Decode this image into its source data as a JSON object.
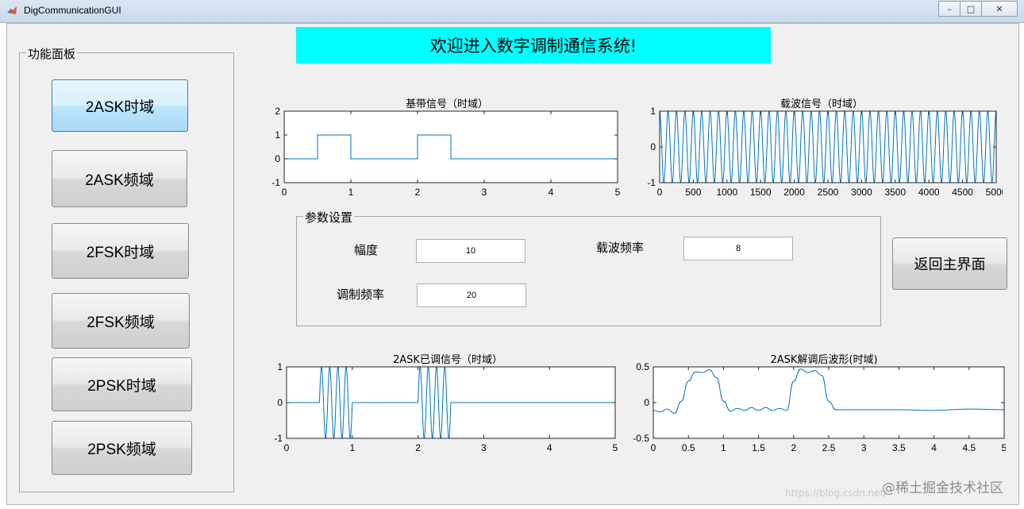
{
  "window": {
    "title": "DigCommunicationGUI"
  },
  "banner": {
    "text": "欢迎进入数字调制通信系统!"
  },
  "function_panel": {
    "title": "功能面板",
    "buttons": [
      "2ASK时域",
      "2ASK频域",
      "2FSK时域",
      "2FSK频域",
      "2PSK时域",
      "2PSK频域"
    ]
  },
  "parameters": {
    "title": "参数设置",
    "amplitude_label": "幅度",
    "amplitude_value": "10",
    "carrier_freq_label": "载波频率",
    "carrier_freq_value": "8",
    "mod_freq_label": "调制频率",
    "mod_freq_value": "20"
  },
  "return_button": "返回主界面",
  "watermark": "https://blog.csdn.net/",
  "watermark2": "@稀土掘金技术社区",
  "line_color": "#0072bd",
  "chart_data": [
    {
      "type": "line",
      "title": "基带信号（时域）",
      "xlim": [
        0,
        5
      ],
      "ylim": [
        -1,
        2
      ],
      "xticks": [
        "0",
        "1",
        "2",
        "3",
        "4",
        "5"
      ],
      "yticks": [
        "-1",
        "0",
        "1",
        "2"
      ],
      "series": [
        {
          "x": [
            0,
            0.5,
            0.5,
            1,
            1,
            2,
            2,
            2.5,
            2.5,
            5
          ],
          "y": [
            0,
            0,
            1,
            1,
            0,
            0,
            1,
            1,
            0,
            0
          ]
        }
      ]
    },
    {
      "type": "line",
      "title": "载波信号（时域）",
      "xlim": [
        0,
        5000
      ],
      "ylim": [
        -1,
        1
      ],
      "xticks": [
        "0",
        "500",
        "1000",
        "1500",
        "2000",
        "2500",
        "3000",
        "3500",
        "4000",
        "4500",
        "5000"
      ],
      "yticks": [
        "-1",
        "0",
        "1"
      ],
      "carrier_cycles": 40
    },
    {
      "type": "line",
      "title": "2ASK已调信号（时域）",
      "xlim": [
        0,
        5
      ],
      "ylim": [
        -1,
        1
      ],
      "xticks": [
        "0",
        "1",
        "2",
        "3",
        "4",
        "5"
      ],
      "yticks": [
        "-1",
        "0",
        "1"
      ],
      "carrier_freq": 8,
      "on_intervals": [
        [
          0.5,
          1
        ],
        [
          2,
          2.5
        ]
      ]
    },
    {
      "type": "line",
      "title": "2ASK解调后波形(时域)",
      "xlim": [
        0,
        5
      ],
      "ylim": [
        -0.5,
        0.5
      ],
      "xticks": [
        "0",
        "0.5",
        "1",
        "1.5",
        "2",
        "2.5",
        "3",
        "3.5",
        "4",
        "4.5",
        "5"
      ],
      "yticks": [
        "-0.5",
        "0",
        "0.5"
      ],
      "series": [
        {
          "x": [
            0,
            0.1,
            0.2,
            0.3,
            0.4,
            0.5,
            0.6,
            0.7,
            0.8,
            0.9,
            1.0,
            1.1,
            1.2,
            1.3,
            1.4,
            1.5,
            1.6,
            1.7,
            1.8,
            1.9,
            2.0,
            2.1,
            2.2,
            2.3,
            2.4,
            2.5,
            2.6,
            2.8,
            3.0,
            3.5,
            4.0,
            4.5,
            5.0
          ],
          "y": [
            -0.11,
            -0.13,
            -0.09,
            -0.15,
            0.02,
            0.3,
            0.43,
            0.42,
            0.46,
            0.35,
            0.02,
            -0.12,
            -0.08,
            -0.11,
            -0.07,
            -0.11,
            -0.07,
            -0.11,
            -0.08,
            -0.11,
            0.3,
            0.47,
            0.42,
            0.45,
            0.38,
            0.02,
            -0.1,
            -0.1,
            -0.1,
            -0.1,
            -0.11,
            -0.09,
            -0.1
          ]
        }
      ]
    }
  ]
}
